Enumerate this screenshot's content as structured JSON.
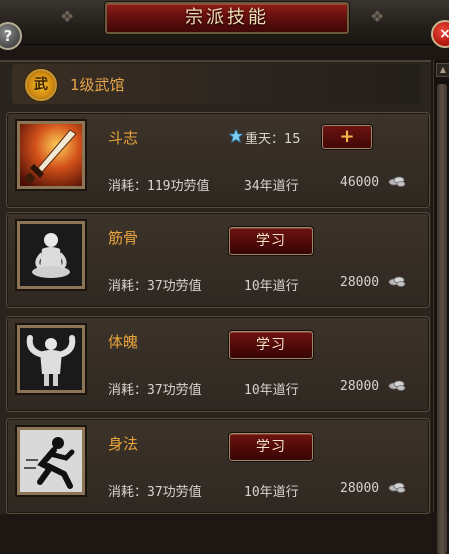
{
  "window": {
    "title": "宗派技能",
    "help_label": "?",
    "close_label": "×"
  },
  "hall": {
    "emblem_glyph": "武",
    "title": "1级武馆"
  },
  "skills": [
    {
      "name": "斗志",
      "icon": "flaming-sword-icon",
      "level_label": "重天：15",
      "action_label": "+",
      "cost_merit": "消耗：119功劳值",
      "cost_years": "34年道行",
      "cost_money": "46000"
    },
    {
      "name": "筋骨",
      "icon": "meditating-figure-icon",
      "action_label": "学习",
      "cost_merit": "消耗：37功劳值",
      "cost_years": "10年道行",
      "cost_money": "28000"
    },
    {
      "name": "体魄",
      "icon": "muscular-figure-icon",
      "action_label": "学习",
      "cost_merit": "消耗：37功劳值",
      "cost_years": "10年道行",
      "cost_money": "28000"
    },
    {
      "name": "身法",
      "icon": "running-figure-icon",
      "action_label": "学习",
      "cost_merit": "消耗：37功劳值",
      "cost_years": "10年道行",
      "cost_money": "28000"
    }
  ],
  "colors": {
    "title_plaque": "#8f1c18",
    "skill_name": "#e9a43d",
    "hall_title": "#e8a44a",
    "button_red": "#6e1411"
  }
}
